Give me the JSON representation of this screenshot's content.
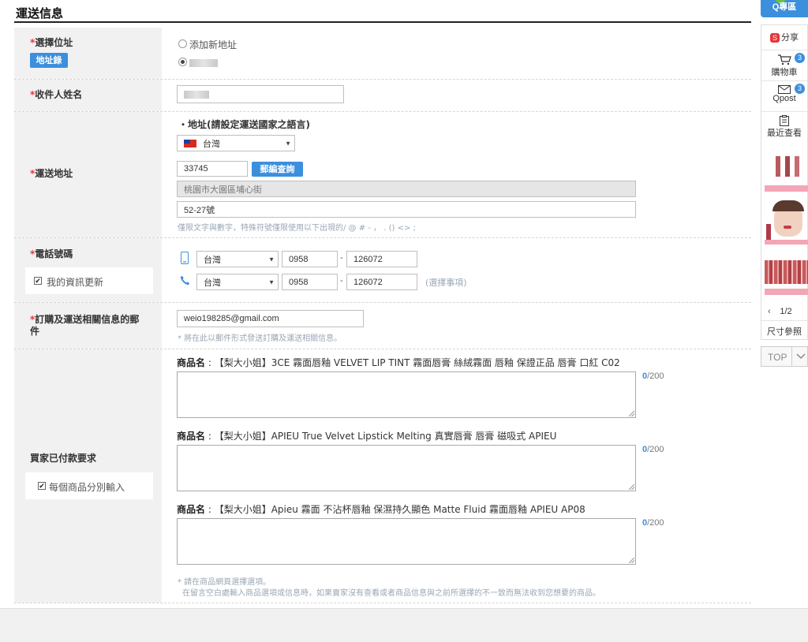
{
  "section": {
    "title": "運送信息"
  },
  "address_select": {
    "label": "選擇位址",
    "book_button": "地址錄",
    "add_new_label": "添加新地址"
  },
  "recipient": {
    "label": "收件人姓名"
  },
  "shipping_address": {
    "label": "運送地址",
    "heading": "・地址(請設定運送國家之語言)",
    "country": "台灣",
    "zipcode": "33745",
    "zip_button": "郵編查詢",
    "line1": "桃園市大園區埔心街",
    "line2": "52-27號",
    "hint": "僅限文字與數字，特殊符號僅限使用以下出現的/ @ # - ， . () <> ;"
  },
  "phone": {
    "label": "電話號碼",
    "update_checkbox": "我的資訊更新",
    "mobile": {
      "country": "台灣",
      "prefix": "0958",
      "number": "126072"
    },
    "home": {
      "country": "台灣",
      "prefix": "0958",
      "number": "126072",
      "optional_note": "(選擇事項)"
    }
  },
  "email": {
    "label": "訂購及運送相關信息的郵件",
    "value": "weio198285@gmail.com",
    "hint": "* 將在此以郵件形式發送訂購及運送相關信息。"
  },
  "buyer_request": {
    "label": "買家已付款要求",
    "per_item_checkbox": "每個商品分別輸入",
    "items": [
      {
        "prefix": "商品名",
        "name": "【梨大小姐】3CE 霧面唇釉 VELVET LIP TINT 霧面唇膏 絲絨霧面 唇釉 保證正品 唇膏 口紅 C02",
        "count": "0",
        "max": "/200"
      },
      {
        "prefix": "商品名",
        "name": "【梨大小姐】APIEU True Velvet Lipstick Melting 真實唇膏 唇膏 磁吸式 APIEU",
        "count": "0",
        "max": "/200"
      },
      {
        "prefix": "商品名",
        "name": "【梨大小姐】Apieu 霧面 不沾杯唇釉 保濕持久顯色 Matte Fluid 霧面唇釉 APIEU AP08",
        "count": "0",
        "max": "/200"
      }
    ],
    "note_line1": "* 請在商品網頁選擇選項。",
    "note_line2": "在留言空白處輸入商品選項或信息時，如果賣家沒有查看或者商品信息與之前所選擇的不一致而無法收到您想要的商品。"
  },
  "sidebar": {
    "q_label": "Q專區",
    "share": "分享",
    "cart": {
      "label": "購物車",
      "count": "3"
    },
    "qpost": {
      "label": "Qpost",
      "count": "3"
    },
    "recent": "最近查看",
    "pager": "1/2",
    "size_ref": "尺寸參照",
    "top": "TOP"
  },
  "colors": {
    "accent": "#3c8fdd",
    "required": "#e5383b",
    "label_bg": "#f1f1f1"
  }
}
